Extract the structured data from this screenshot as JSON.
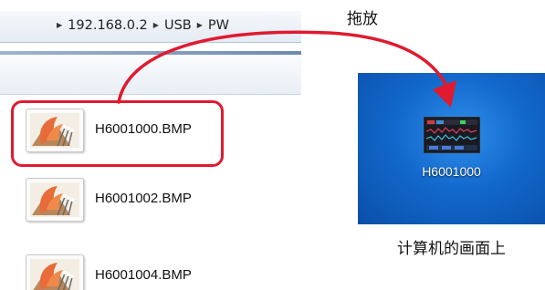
{
  "explorer": {
    "breadcrumb": [
      "192.168.0.2",
      "USB",
      "PW"
    ],
    "files": [
      {
        "name": "H6001000.BMP"
      },
      {
        "name": "H6001002.BMP"
      },
      {
        "name": "H6001004.BMP"
      }
    ]
  },
  "annotation": {
    "drag_label": "拖放",
    "desktop_caption": "计算机的画面上"
  },
  "desktop": {
    "file_label": "H6001000"
  },
  "colors": {
    "highlight": "#e01a2f",
    "desktop_blue": "#1268cc"
  },
  "icons": {
    "file_thumbnail": "image-thumbnail-icon",
    "desktop_file": "oscilloscope-screenshot-icon",
    "breadcrumb_separator": "triangle-right-icon"
  }
}
